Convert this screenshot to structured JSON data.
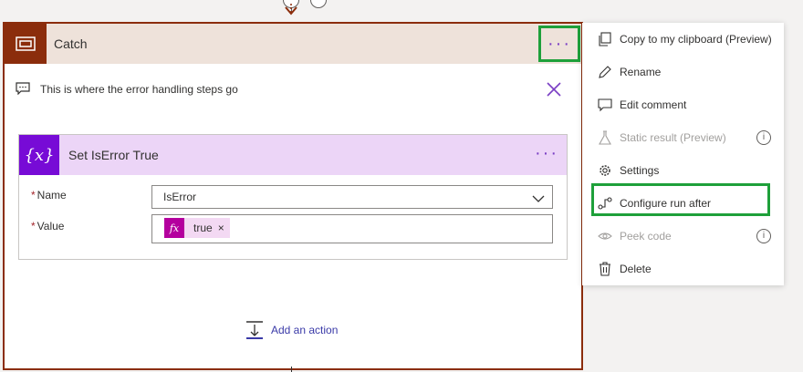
{
  "scope": {
    "title": "Catch",
    "more_label": "···",
    "comment": "This is where the error handling steps go"
  },
  "action": {
    "icon_label": "{x}",
    "title": "Set IsError True",
    "more_label": "···",
    "fields": {
      "name_label": "Name",
      "name_value": "IsError",
      "value_label": "Value",
      "required_mark": "*",
      "value_token": {
        "icon_label": "fx",
        "text": "true",
        "remove_label": "×"
      }
    }
  },
  "add_action": {
    "label": "Add an action"
  },
  "menu": {
    "items": [
      {
        "label": "Copy to my clipboard (Preview)",
        "icon": "copy-icon",
        "disabled": false,
        "info": false
      },
      {
        "label": "Rename",
        "icon": "pencil-icon",
        "disabled": false,
        "info": false
      },
      {
        "label": "Edit comment",
        "icon": "comment-icon",
        "disabled": false,
        "info": false
      },
      {
        "label": "Static result (Preview)",
        "icon": "flask-icon",
        "disabled": true,
        "info": true
      },
      {
        "label": "Settings",
        "icon": "gear-icon",
        "disabled": false,
        "info": false
      },
      {
        "label": "Configure run after",
        "icon": "run-after-icon",
        "disabled": false,
        "info": false
      },
      {
        "label": "Peek code",
        "icon": "eye-icon",
        "disabled": true,
        "info": true
      },
      {
        "label": "Delete",
        "icon": "trash-icon",
        "disabled": false,
        "info": false
      }
    ],
    "info_glyph": "i"
  },
  "colors": {
    "scope_brand": "#8b2d0c",
    "variable_brand": "#770bd6",
    "expression_brand": "#b4009e",
    "highlight": "#1ea03a",
    "link": "#3a3aa8"
  }
}
